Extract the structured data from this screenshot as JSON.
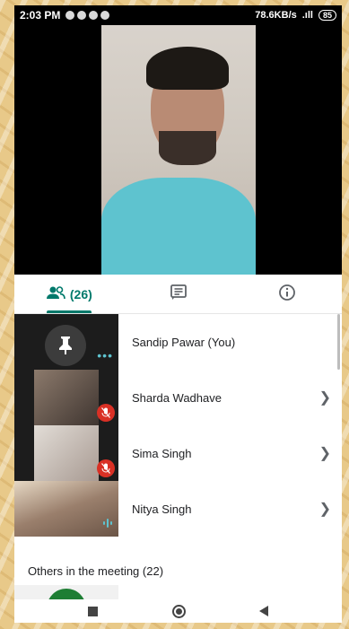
{
  "status_bar": {
    "time": "2:03 PM",
    "network_speed": "78.6KB/s",
    "signal_text": ".ıll",
    "battery": "85"
  },
  "tabs": [
    {
      "label": "(26)",
      "icon": "people-icon",
      "active": true
    },
    {
      "label": "",
      "icon": "chat-icon",
      "active": false
    },
    {
      "label": "",
      "icon": "info-icon",
      "active": false
    }
  ],
  "participants": [
    {
      "name": "Sandip Pawar (You)",
      "status": "more-options",
      "chevron": false
    },
    {
      "name": "Sharda Wadhave",
      "status": "muted",
      "chevron": true
    },
    {
      "name": "Sima Singh",
      "status": "muted",
      "chevron": true
    },
    {
      "name": "Nitya Singh",
      "status": "speaking",
      "chevron": true
    }
  ],
  "others_label": "Others in the meeting (22)",
  "colors": {
    "accent": "#00796b",
    "muted": "#d93025",
    "speaking": "#5ec3cf"
  }
}
